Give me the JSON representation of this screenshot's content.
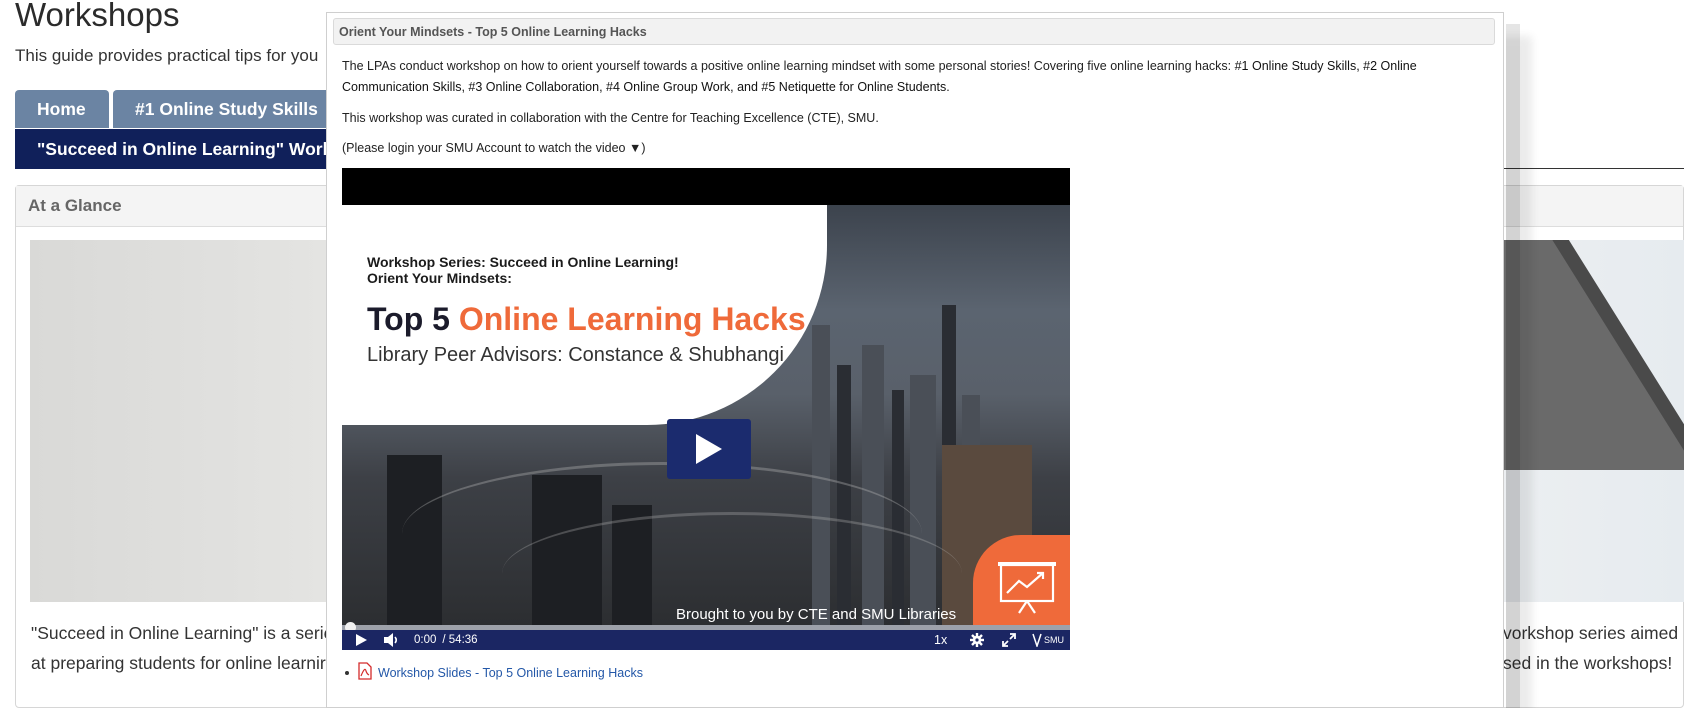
{
  "page": {
    "title": "Workshops",
    "description": "This guide provides practical tips for you"
  },
  "tabs": {
    "home": "Home",
    "study_skills": "#1 Online Study Skills",
    "active": "\"Succeed in Online Learning\" Work"
  },
  "glance": {
    "header": "At a Glance",
    "left_line1": "\"Succeed in Online Learning\" is a serie",
    "left_line2": "at preparing students for online learnir",
    "right_line1": "vorkshop series aimed",
    "right_line2": "sed in the workshops!"
  },
  "modal": {
    "title": "Orient Your Mindsets - Top 5 Online Learning Hacks",
    "p1_prefix": "The LPAs conduct workshop on how to orient yourself towards a positive online learning mindset with some personal stories! Covering five online learning hacks: ",
    "p1_hacks": "#1 Online Study Skills, #2 Online Communication Skills, #3 Online Collaboration, #4 Online Group Work, and #5 Netiquette for Online Students",
    "p1_suffix": ".",
    "p2": "This workshop was curated in collaboration with the Centre for Teaching Excellence (CTE), SMU.",
    "p3": "(Please login your SMU Account to watch the video ▼)"
  },
  "video": {
    "series_line1": "Workshop Series: Succeed in Online Learning!",
    "series_line2": "Orient Your Mindsets:",
    "main_title_prefix": "Top 5 ",
    "main_title_accent": "Online Learning Hacks",
    "subtitle": "Library Peer Advisors: Constance & Shubhangi",
    "brought_by": "Brought to you by CTE and SMU Libraries",
    "current_time": "0:00",
    "duration": "/ 54:36",
    "speed": "1x",
    "progress": 0,
    "logo_text": "SMU",
    "accent_color": "#ef6a3a",
    "player_color": "#1b2663"
  },
  "attachments": {
    "slides_link": "Workshop Slides - Top 5 Online Learning Hacks",
    "slides_icon": "pdf-icon"
  }
}
